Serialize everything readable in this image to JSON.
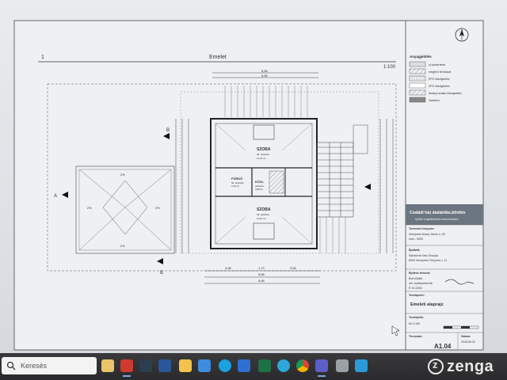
{
  "drawing": {
    "sheet_number": "1",
    "floor_label": "Emelet",
    "scale": "1:100",
    "dims_top": [
      "8,86",
      "8,86"
    ],
    "dims_bottom": [
      "3,58",
      "1,72",
      "3,56",
      "8,86",
      "8,86"
    ],
    "section_marks": [
      "A",
      "B",
      "B"
    ],
    "rooms": [
      {
        "name": "SZOBA",
        "sub": "fal: parketta",
        "area": "11,62 m²"
      },
      {
        "name": "FÜRDŐ",
        "sub": "fal: burkolat",
        "area": "3,76 m²"
      },
      {
        "name": "KÖZL",
        "sub": "parketta",
        "area": "4,58 m²"
      },
      {
        "name": "SZOBA",
        "sub": "fal: parketta",
        "area": "11,61 m²"
      }
    ],
    "roof_slopes": [
      "2%",
      "2%",
      "2%",
      "2%"
    ]
  },
  "legend": {
    "title": "Anyagjelölés",
    "items": [
      "új vázkerámia",
      "meglévő tél falazat",
      "EPS hőszigetelés",
      "XPS hőszigetelés",
      "ásványi szálas hőszigetelés",
      "Vasbeton"
    ]
  },
  "title_block": {
    "project_title": "Családi ház átalakítás,bővítés",
    "project_subtitle": "építési engedélyezési dokumentáció",
    "site_label": "Tervezési helyszín:",
    "site_lines": [
      "Veszprém Arany János u. 25",
      "hrsz.: 3925"
    ],
    "client_label": "Építtető:",
    "client_lines": [
      "Sándorné Kiss Orsolya",
      "8200 Veszprém Fenyves u. 11"
    ],
    "designer_label": "Építész tervező:",
    "designer_lines": [
      "Bors Bálint",
      "okl. építészmérnök",
      "É 19-0394"
    ],
    "drawing_label": "Tervlapnév:",
    "drawing_name": "Emeleti alaprajz",
    "scale_label": "Tervlépték:",
    "scale_value": "M=1:100",
    "sheet_label": "Tervszám:",
    "sheet_no": "A1.04",
    "date_label": "Dátum:",
    "date_value": "2018.05.31"
  },
  "taskbar": {
    "search_placeholder": "Keresés",
    "apps": [
      "file-explorer-icon",
      "acrobat-icon",
      "calculator-icon",
      "word-icon",
      "folder-icon",
      "network-icon",
      "skype-icon",
      "mail-icon",
      "excel-icon",
      "edge-icon",
      "chrome-icon",
      "teams-icon",
      "calculator2-icon",
      "photos-icon"
    ],
    "watermark": "zenga"
  },
  "colors": {
    "line": "#3a3a3a",
    "screen": "#e4e6e9",
    "taskbar": "#2e2e30",
    "title_band": "#6b7680",
    "watermark": "#e8e8e8"
  }
}
